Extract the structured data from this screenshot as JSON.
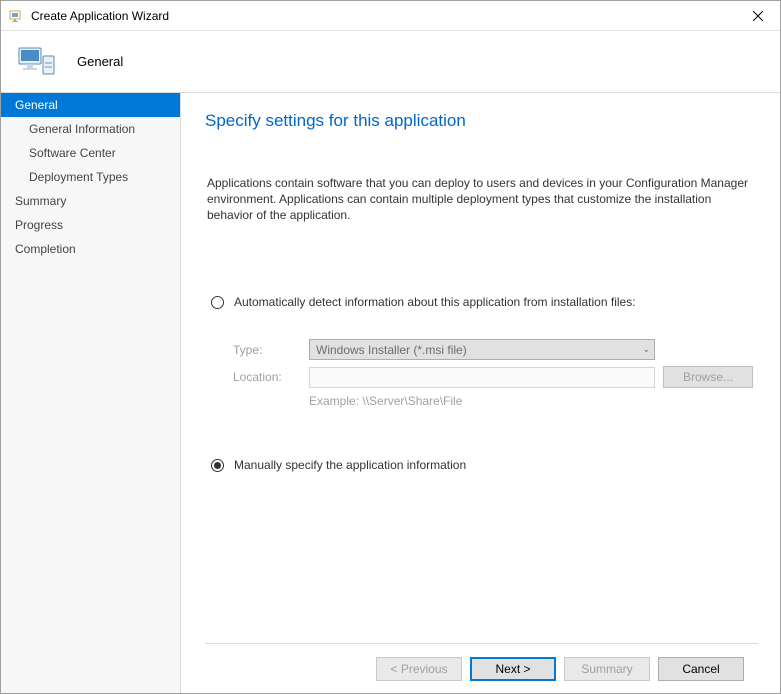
{
  "titlebar": {
    "text": "Create Application Wizard"
  },
  "header": {
    "title": "General"
  },
  "sidebar": {
    "items": [
      {
        "label": "General",
        "selected": true,
        "sub": false
      },
      {
        "label": "General Information",
        "selected": false,
        "sub": true
      },
      {
        "label": "Software Center",
        "selected": false,
        "sub": true
      },
      {
        "label": "Deployment Types",
        "selected": false,
        "sub": true
      },
      {
        "label": "Summary",
        "selected": false,
        "sub": false
      },
      {
        "label": "Progress",
        "selected": false,
        "sub": false
      },
      {
        "label": "Completion",
        "selected": false,
        "sub": false
      }
    ]
  },
  "content": {
    "heading": "Specify settings for this application",
    "desc": "Applications contain software that you can deploy to users and devices in your Configuration Manager environment. Applications can contain multiple deployment types that customize the installation behavior of the application.",
    "radio_auto_label": "Automatically detect information about this application from installation files:",
    "radio_manual_label": "Manually specify the application information",
    "type_label": "Type:",
    "type_value": "Windows Installer (*.msi file)",
    "location_label": "Location:",
    "location_value": "",
    "browse_label": "Browse...",
    "example_label": "Example: \\\\Server\\Share\\File",
    "selected_radio": "manual"
  },
  "footer": {
    "previous": "< Previous",
    "next": "Next >",
    "summary": "Summary",
    "cancel": "Cancel"
  }
}
